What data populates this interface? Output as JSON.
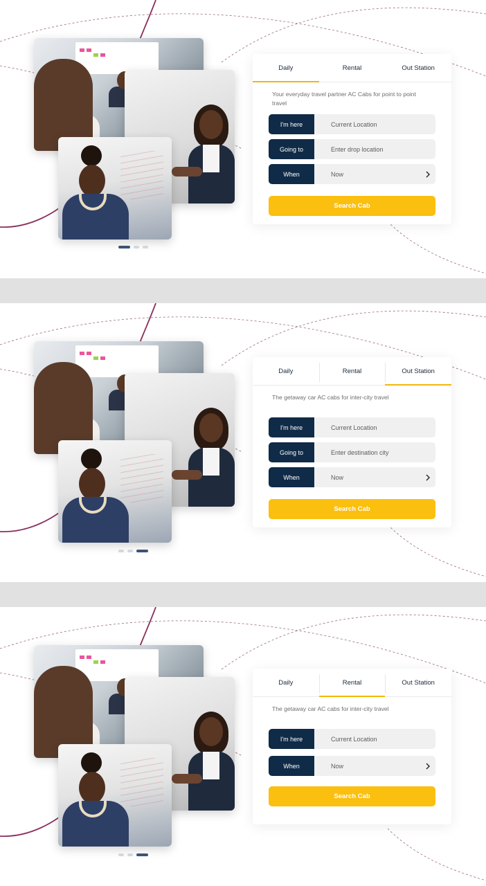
{
  "variants": [
    {
      "tabs": [
        "Daily",
        "Rental",
        "Out Station"
      ],
      "active_tab": "Daily",
      "tagline": "Your everyday travel partner AC Cabs for point to point travel",
      "fields": [
        {
          "label": "I'm here",
          "value": "Current Location"
        },
        {
          "label": "Going to",
          "value": "Enter drop location"
        },
        {
          "label": "When",
          "value": "Now"
        }
      ],
      "button": "Search Cab",
      "carousel_active_index": 0
    },
    {
      "tabs": [
        "Daily",
        "Rental",
        "Out Station"
      ],
      "active_tab": "Out Station",
      "tagline": "The getaway car AC cabs for inter-city travel",
      "fields": [
        {
          "label": "I'm here",
          "value": "Current Location"
        },
        {
          "label": "Going to",
          "value": "Enter destination city"
        },
        {
          "label": "When",
          "value": "Now"
        }
      ],
      "button": "Search Cab",
      "carousel_active_index": 2
    },
    {
      "tabs": [
        "Daily",
        "Rental",
        "Out Station"
      ],
      "active_tab": "Rental",
      "tagline": "The getaway car AC cabs for inter-city travel",
      "fields": [
        {
          "label": "I'm here",
          "value": "Current Location"
        },
        {
          "label": "When",
          "value": "Now"
        }
      ],
      "button": "Search Cab",
      "carousel_active_index": 2
    }
  ],
  "colors": {
    "navy": "#0f2b47",
    "accent_yellow": "#fbbf0f",
    "tab_underline": "#f2b705",
    "dot_active": "#3f5275",
    "curve_maroon": "#8b2f5c"
  },
  "icons": {
    "when_chevron": "chevron-right-icon"
  }
}
